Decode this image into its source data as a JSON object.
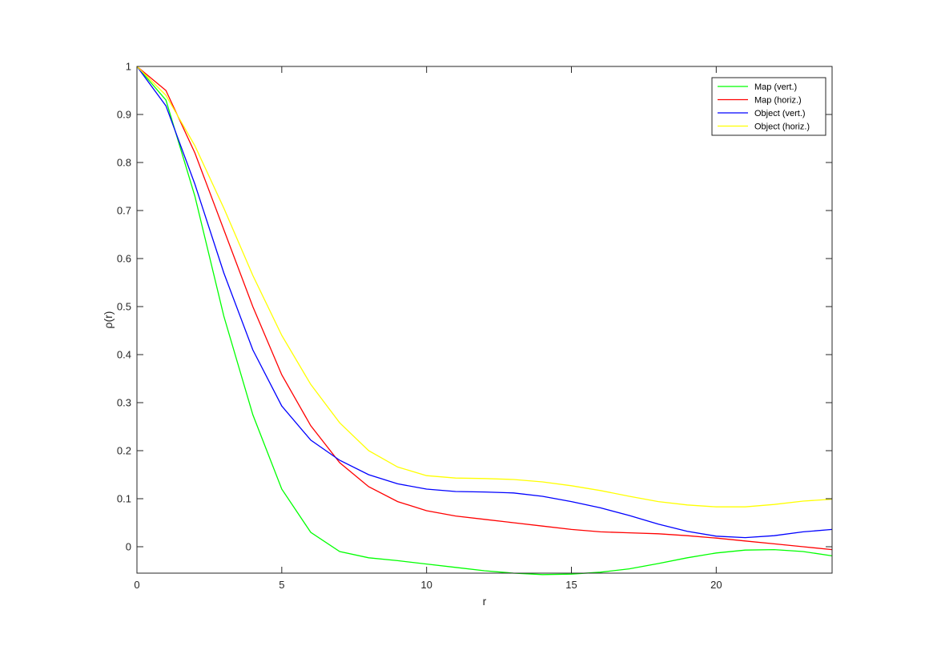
{
  "chart_data": {
    "type": "line",
    "title": "",
    "xlabel": "r",
    "ylabel": "ρ(r)",
    "xlim": [
      0,
      24
    ],
    "ylim": [
      -0.055,
      1
    ],
    "xticks": [
      0,
      5,
      10,
      15,
      20
    ],
    "xtick_labels": [
      "0",
      "5",
      "10",
      "15",
      "20"
    ],
    "yticks": [
      0,
      0.1,
      0.2,
      0.3,
      0.4,
      0.5,
      0.6,
      0.7,
      0.8,
      0.9,
      1
    ],
    "ytick_labels": [
      "0",
      "0.1",
      "0.2",
      "0.3",
      "0.4",
      "0.5",
      "0.6",
      "0.7",
      "0.8",
      "0.9",
      "1"
    ],
    "grid": false,
    "legend_position": "top-right",
    "x": [
      0,
      1,
      2,
      3,
      4,
      5,
      6,
      7,
      8,
      9,
      10,
      11,
      12,
      13,
      14,
      15,
      16,
      17,
      18,
      19,
      20,
      21,
      22,
      23,
      24
    ],
    "series": [
      {
        "name": "Map (vert.)",
        "color": "#00ff00",
        "values": [
          1,
          0.93,
          0.73,
          0.48,
          0.275,
          0.12,
          0.03,
          -0.01,
          -0.023,
          -0.029,
          -0.036,
          -0.043,
          -0.05,
          -0.055,
          -0.058,
          -0.057,
          -0.053,
          -0.046,
          -0.035,
          -0.023,
          -0.013,
          -0.007,
          -0.006,
          -0.01,
          -0.019
        ]
      },
      {
        "name": "Map (horiz.)",
        "color": "#ff0000",
        "values": [
          1,
          0.95,
          0.82,
          0.66,
          0.5,
          0.358,
          0.252,
          0.175,
          0.125,
          0.094,
          0.075,
          0.064,
          0.057,
          0.05,
          0.043,
          0.036,
          0.031,
          0.029,
          0.027,
          0.023,
          0.018,
          0.012,
          0.006,
          0.0,
          -0.006
        ]
      },
      {
        "name": "Object (vert.)",
        "color": "#0000ff",
        "values": [
          1,
          0.918,
          0.755,
          0.57,
          0.41,
          0.293,
          0.222,
          0.18,
          0.15,
          0.131,
          0.12,
          0.115,
          0.114,
          0.112,
          0.105,
          0.094,
          0.081,
          0.065,
          0.047,
          0.032,
          0.022,
          0.019,
          0.023,
          0.031,
          0.036
        ]
      },
      {
        "name": "Object (horiz.)",
        "color": "#ffff00",
        "values": [
          1,
          0.94,
          0.835,
          0.705,
          0.565,
          0.44,
          0.338,
          0.258,
          0.2,
          0.166,
          0.148,
          0.143,
          0.142,
          0.14,
          0.135,
          0.127,
          0.117,
          0.105,
          0.094,
          0.087,
          0.083,
          0.083,
          0.088,
          0.095,
          0.099
        ]
      }
    ]
  }
}
